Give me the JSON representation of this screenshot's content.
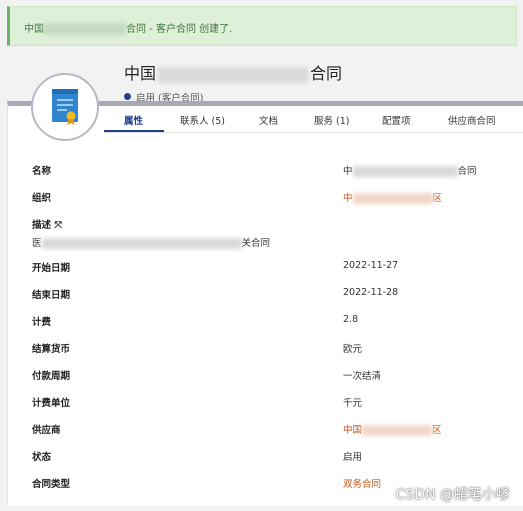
{
  "banner": {
    "prefix": "中国",
    "suffix": "合同 - 客户合同 创建了."
  },
  "header": {
    "title_prefix": "中国",
    "title_suffix": "合同",
    "status": "启用 (客户合同)"
  },
  "tabs": [
    {
      "label": "属性"
    },
    {
      "label": "联系人 (5)"
    },
    {
      "label": "文档"
    },
    {
      "label": "服务 (1)"
    },
    {
      "label": "配置项"
    },
    {
      "label": "供应商合同"
    }
  ],
  "properties": {
    "name": {
      "label": "名称",
      "value_prefix": "中",
      "value_suffix": "合同"
    },
    "org": {
      "label": "组织",
      "value_prefix": "中",
      "value_suffix": "区"
    },
    "description": {
      "label": "描述",
      "icon": "expand-arrows-icon",
      "value_prefix": "医",
      "value_suffix": "关合同"
    },
    "start_date": {
      "label": "开始日期",
      "value": "2022-11-27"
    },
    "end_date": {
      "label": "结束日期",
      "value": "2022-11-28"
    },
    "cost": {
      "label": "计费",
      "value": "2.8"
    },
    "currency": {
      "label": "结算货币",
      "value": "欧元"
    },
    "payment": {
      "label": "付款周期",
      "value": "一次结清"
    },
    "cost_unit": {
      "label": "计费单位",
      "value": "千元"
    },
    "provider": {
      "label": "供应商",
      "value_prefix": "中国",
      "value_suffix": "区"
    },
    "status": {
      "label": "状态",
      "value": "启用"
    },
    "type": {
      "label": "合同类型",
      "value": "双务合同"
    }
  },
  "watermark": "CSDN @蜡笔小嗲",
  "colors": {
    "accent": "#23408e",
    "link": "#c0531b",
    "success_bg": "#dff0d8",
    "success_text": "#3c763d"
  }
}
